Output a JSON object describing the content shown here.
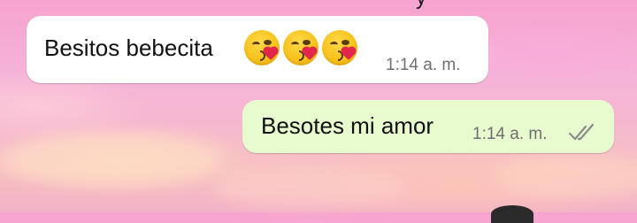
{
  "chat": {
    "messages": [
      {
        "direction": "incoming",
        "text": "Besitos bebecita",
        "emojis": [
          "face-blowing-a-kiss",
          "face-blowing-a-kiss",
          "face-blowing-a-kiss"
        ],
        "time": "1:14 a. m."
      },
      {
        "direction": "outgoing",
        "text": "Besotes mi amor",
        "time": "1:14 a. m.",
        "status": "read-double-check"
      }
    ]
  },
  "colors": {
    "incoming_bubble": "#ffffff",
    "outgoing_bubble": "#e8fbcf",
    "time_text": "#6f6f6f",
    "message_text": "#111111",
    "wallpaper": "#f5b3d8"
  }
}
